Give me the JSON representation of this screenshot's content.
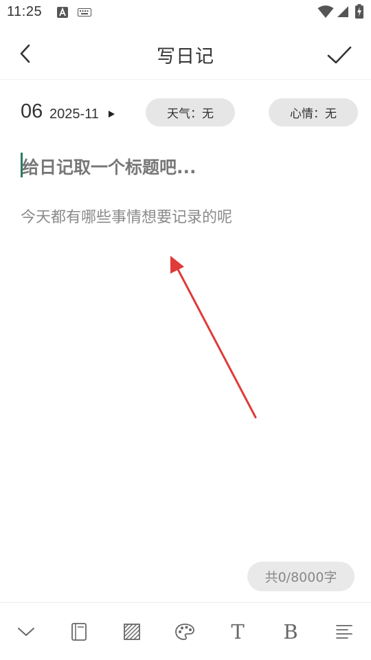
{
  "status_bar": {
    "time": "11:25",
    "icons": [
      "text-input-a-icon",
      "keyboard-icon",
      "wifi-icon",
      "cell-signal-icon",
      "battery-charging-icon"
    ]
  },
  "header": {
    "title": "写日记",
    "back_icon": "chevron-left-icon",
    "confirm_icon": "check-icon"
  },
  "date": {
    "day": "06",
    "year_month": "2025-11",
    "caret_icon": "caret-right-icon"
  },
  "weather_pill": {
    "label": "天气：无"
  },
  "mood_pill": {
    "label": "心情：无"
  },
  "editor": {
    "title_placeholder": "给日记取一个标题吧...",
    "body_placeholder": "今天都有哪些事情想要记录的呢"
  },
  "word_count": {
    "text": "共0/8000字"
  },
  "toolbar": {
    "items": [
      {
        "icon": "collapse-keyboard-icon"
      },
      {
        "icon": "notebook-icon"
      },
      {
        "icon": "background-pattern-icon"
      },
      {
        "icon": "palette-icon"
      },
      {
        "icon": "font-icon",
        "label": "T"
      },
      {
        "icon": "bold-icon",
        "label": "B"
      },
      {
        "icon": "align-icon"
      }
    ]
  },
  "colors": {
    "accent_cursor": "#2a7a66",
    "annotation_arrow": "#e03a3a",
    "pill_bg": "#e6e6e6"
  }
}
